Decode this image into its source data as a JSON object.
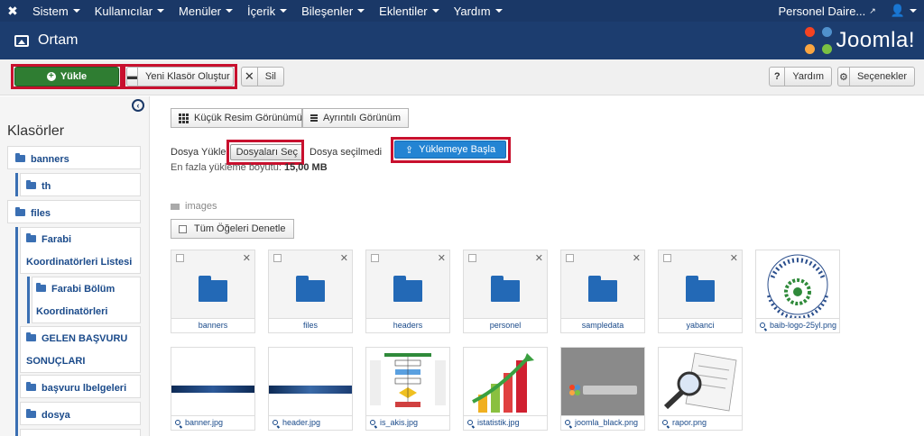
{
  "topbar": {
    "menu": [
      {
        "label": "Sistem"
      },
      {
        "label": "Kullanıcılar"
      },
      {
        "label": "Menüler"
      },
      {
        "label": "İçerik"
      },
      {
        "label": "Bileşenler"
      },
      {
        "label": "Eklentiler"
      },
      {
        "label": "Yardım"
      }
    ],
    "site_label": "Personel Daire..."
  },
  "header": {
    "title": "Ortam",
    "logo_text": "Joomla!"
  },
  "toolbar": {
    "upload": "Yükle",
    "new_folder": "Yeni Klasör Oluştur",
    "delete": "Sil",
    "help": "Yardım",
    "options": "Seçenekler"
  },
  "sidebar": {
    "heading": "Klasörler",
    "folders": [
      "banners",
      "th",
      "files",
      "Farabi",
      "Koordinatörleri Listesi",
      "Farabi Bölüm",
      "Koordinatörleri",
      "GELEN BAŞVURU",
      "SONUÇLARI",
      "başvuru lbelgeleri",
      "dosya"
    ]
  },
  "main": {
    "thumb_view": "Küçük Resim Görünümü",
    "detail_view": "Ayrıntılı Görünüm",
    "upload_label": "Dosya Yükle",
    "choose_files": "Dosyaları Seç",
    "no_file": "Dosya seçilmedi",
    "max_size_label": "En fazla yükleme boyutu:",
    "max_size_value": "15,00 MB",
    "start_upload": "Yüklemeye Başla",
    "path": "images",
    "check_all": "Tüm Öğeleri Denetle",
    "folders": [
      "banners",
      "files",
      "headers",
      "personel",
      "sampledata",
      "yabanci"
    ],
    "images": [
      "baib-logo-25yl.png",
      "banner.jpg",
      "header.jpg",
      "is_akis.jpg",
      "istatistik.jpg",
      "joomla_black.png",
      "rapor.png"
    ]
  },
  "colors": {
    "navbar": "#1a3867",
    "header": "#1c3d6f",
    "upload_green": "#2f7d32",
    "start_blue": "#2384d3",
    "highlight_red": "#c8102e",
    "folder_blue": "#2369b6"
  }
}
